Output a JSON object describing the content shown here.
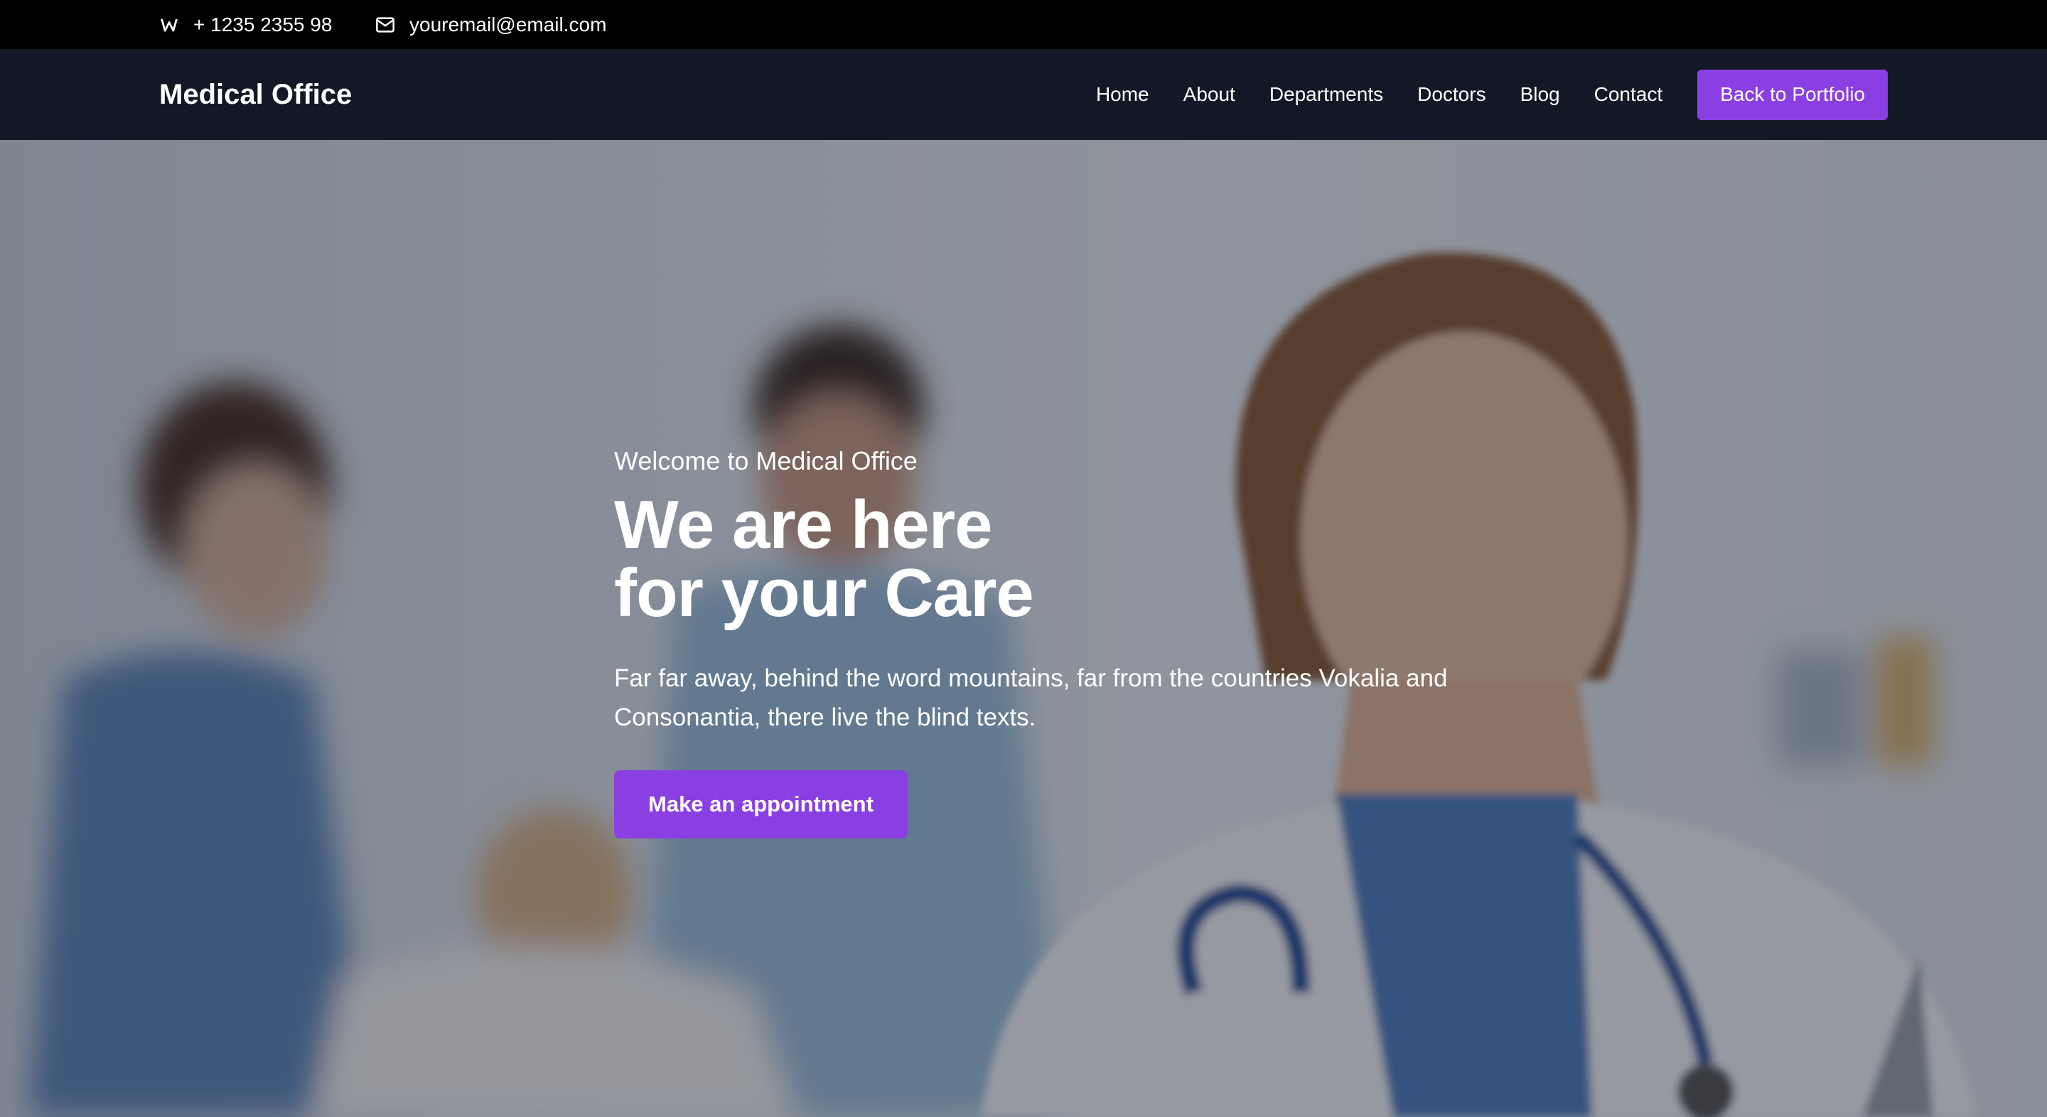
{
  "topbar": {
    "phone_icon": "phone-icon",
    "phone": "+ 1235 2355 98",
    "email_icon": "envelope-icon",
    "email": "youremail@email.com"
  },
  "navbar": {
    "brand": "Medical Office",
    "links": [
      "Home",
      "About",
      "Departments",
      "Doctors",
      "Blog",
      "Contact"
    ],
    "button": "Back to Portfolio"
  },
  "hero": {
    "eyebrow": "Welcome to Medical Office",
    "headline_line1": "We are here",
    "headline_line2": "for your Care",
    "lead": "Far far away, behind the word mountains, far from the countries Vokalia and Consonantia, there live the blind texts.",
    "cta": "Make an appointment"
  },
  "colors": {
    "accent": "#8a3fe3",
    "topbar_bg": "#000000",
    "navbar_bg": "#121826"
  }
}
